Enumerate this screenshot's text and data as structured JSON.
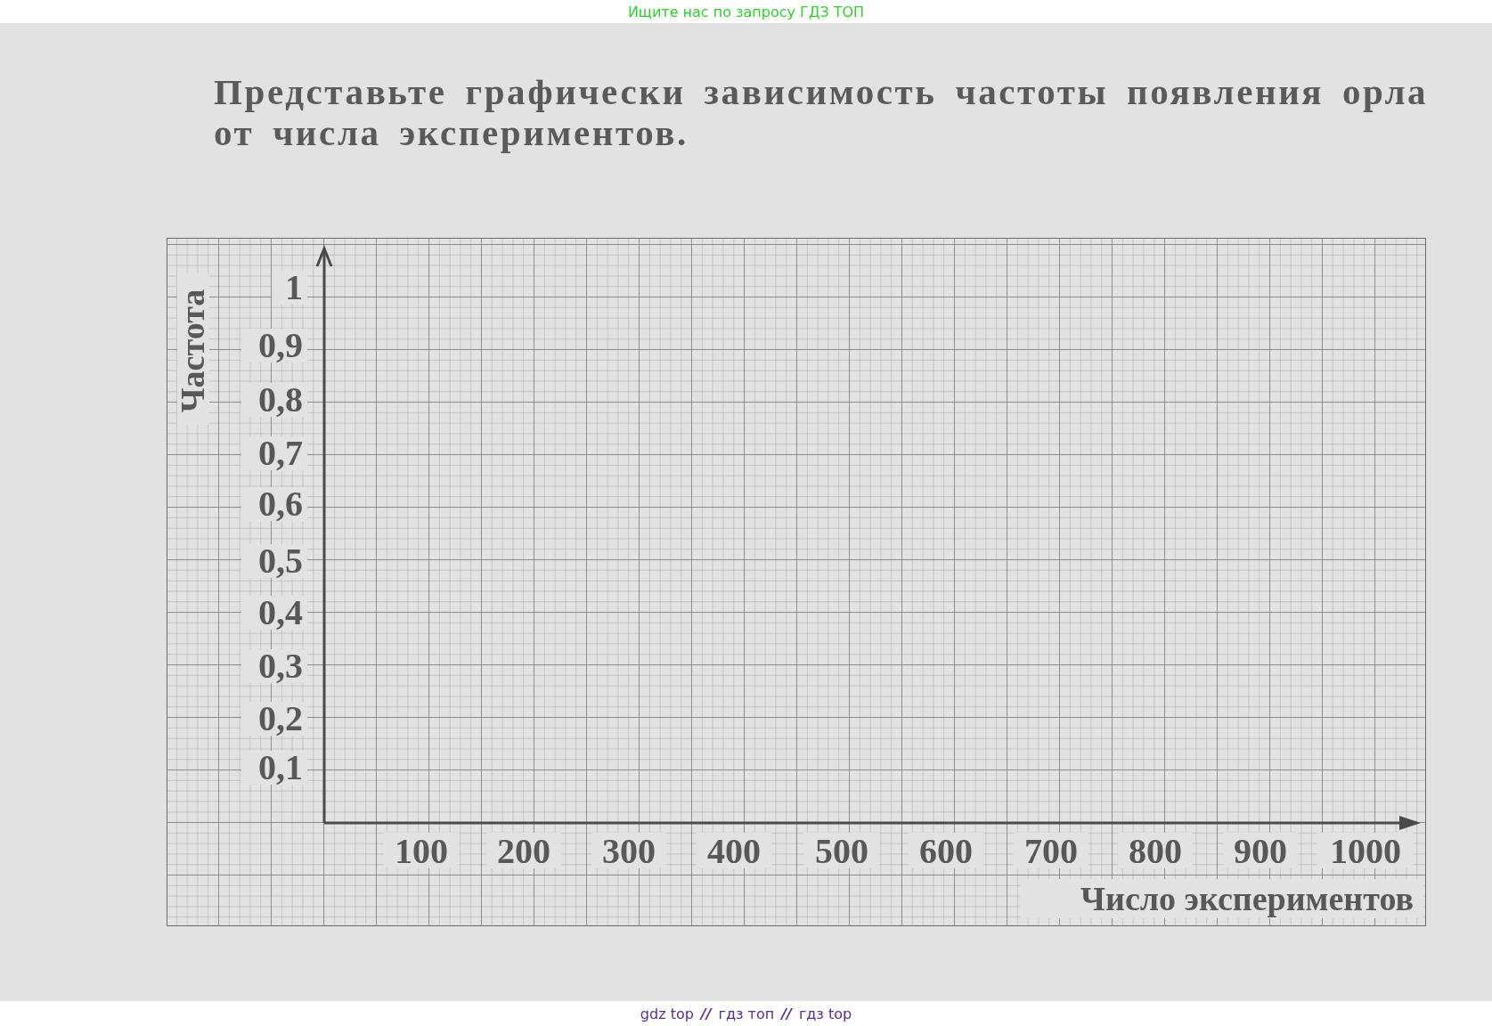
{
  "header": {
    "text": "Ищите нас по запросу ГДЗ ТОП"
  },
  "task": {
    "text": "Представьте графически зависимость частоты появления орла от числа экспериментов."
  },
  "graph": {
    "y_axis_title": "Частота",
    "y_ticks": [
      "1",
      "0,9",
      "0,8",
      "0,7",
      "0,6",
      "0,5",
      "0,4",
      "0,3",
      "0,2",
      "0,1"
    ],
    "x_ticks": [
      "100",
      "200",
      "300",
      "400",
      "500",
      "600",
      "700",
      "800",
      "900",
      "1000"
    ],
    "x_axis_title": "Число экспериментов"
  },
  "footer": [
    {
      "kind": "link",
      "text": "gdz top"
    },
    {
      "kind": "separator",
      "text": "//"
    },
    {
      "kind": "link",
      "text": "гдз топ"
    },
    {
      "kind": "separator",
      "text": "//"
    },
    {
      "kind": "link",
      "text": "гдз top"
    }
  ]
}
